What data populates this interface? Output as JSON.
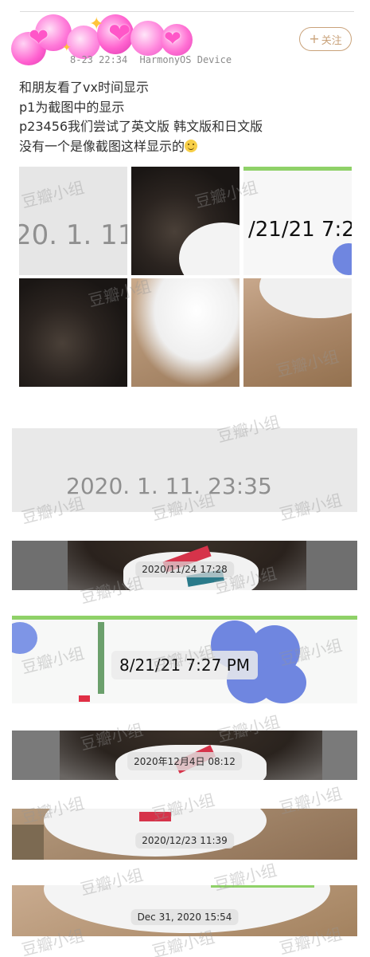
{
  "post": {
    "meta_date": "8-23 22:34",
    "meta_device": "HarmonyOS Device",
    "follow_label": "关注",
    "lines": [
      "和朋友看了vx时间显示",
      "p1为截图中的显示",
      "p23456我们尝试了英文版 韩文版和日文版",
      "没有一个是像截图这样显示的"
    ]
  },
  "thumbnails": {
    "t1_text": "20. 1. 11",
    "t3_text": "/21/21 7:2"
  },
  "images": [
    {
      "timestamp": "2020. 1. 11. 23:35"
    },
    {
      "timestamp": "2020/11/24 17:28"
    },
    {
      "timestamp": "8/21/21 7:27 PM"
    },
    {
      "timestamp": "2020年12月4日 08:12"
    },
    {
      "timestamp": "2020/12/23 11:39"
    },
    {
      "timestamp": "Dec 31, 2020 15:54"
    }
  ],
  "watermark_text": "豆瓣小组",
  "colors": {
    "follow": "#c9a27a",
    "green_bar": "#8fd168",
    "flower_blue": "#6f86e0"
  }
}
